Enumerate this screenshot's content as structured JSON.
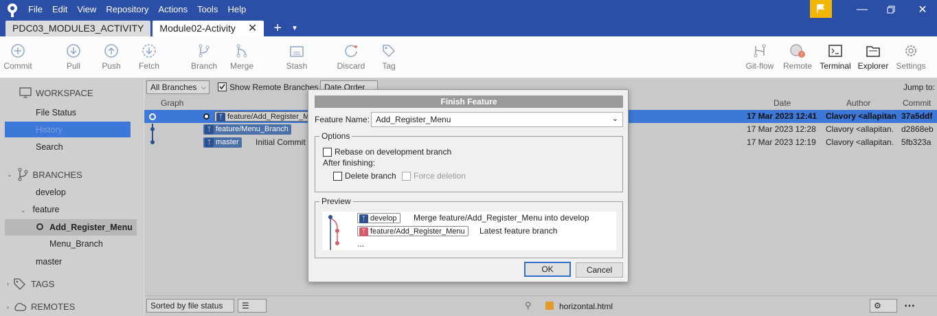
{
  "menu": [
    "File",
    "Edit",
    "View",
    "Repository",
    "Actions",
    "Tools",
    "Help"
  ],
  "tabs": {
    "inactive_label": "PDC03_MODULE3_ACTIVITY",
    "active_label": "Module02-Activity"
  },
  "toolbar": {
    "commit": "Commit",
    "pull": "Pull",
    "push": "Push",
    "fetch": "Fetch",
    "branch": "Branch",
    "merge": "Merge",
    "stash": "Stash",
    "discard": "Discard",
    "tag": "Tag",
    "gitflow": "Git-flow",
    "remote": "Remote",
    "terminal": "Terminal",
    "explorer": "Explorer",
    "settings": "Settings"
  },
  "sidebar": {
    "workspace": "WORKSPACE",
    "file_status": "File Status",
    "history": "History",
    "search": "Search",
    "branches": "BRANCHES",
    "develop": "develop",
    "feature": "feature",
    "add_register_menu": "Add_Register_Menu",
    "menu_branch": "Menu_Branch",
    "master": "master",
    "tags": "TAGS",
    "remotes": "REMOTES"
  },
  "filters": {
    "all_branches": "All Branches",
    "show_remote": "Show Remote Branches",
    "date_order": "Date Order",
    "jump_to": "Jump to:"
  },
  "columns": {
    "graph": "Graph",
    "date": "Date",
    "author": "Author",
    "commit": "Commit"
  },
  "commits": [
    {
      "branch": "feature/Add_Register_M",
      "desc": "",
      "date": "17 Mar 2023 12:41",
      "author": "Clavory <allapitan",
      "hash": "37a5ddf"
    },
    {
      "branch": "feature/Menu_Branch",
      "desc": "",
      "date": "17 Mar 2023 12:28",
      "author": "Clavory <allapitan.",
      "hash": "d2868eb"
    },
    {
      "branch": "master",
      "desc": "Initial Commit",
      "date": "17 Mar 2023 12:19",
      "author": "Clavory <allapitan.",
      "hash": "5fb323a"
    }
  ],
  "bottom": {
    "sorted": "Sorted by file status",
    "file": "horizontal.html"
  },
  "dialog": {
    "title": "Finish Feature",
    "feature_name_label": "Feature Name:",
    "feature_name_value": "Add_Register_Menu",
    "options_legend": "Options",
    "rebase": "Rebase on development branch",
    "after_finishing": "After finishing:",
    "delete_branch": "Delete branch",
    "force_deletion": "Force deletion",
    "preview_legend": "Preview",
    "preview_develop": "develop",
    "preview_develop_text": "Merge feature/Add_Register_Menu into develop",
    "preview_feature": "feature/Add_Register_Menu",
    "preview_feature_text": "Latest feature branch",
    "preview_more": "...",
    "ok": "OK",
    "cancel": "Cancel"
  },
  "colors": {
    "titlebar": "#2b4fa6",
    "selection": "#3d78d8",
    "flag": "#f2b705",
    "feature_badge": "#d45c6a"
  }
}
